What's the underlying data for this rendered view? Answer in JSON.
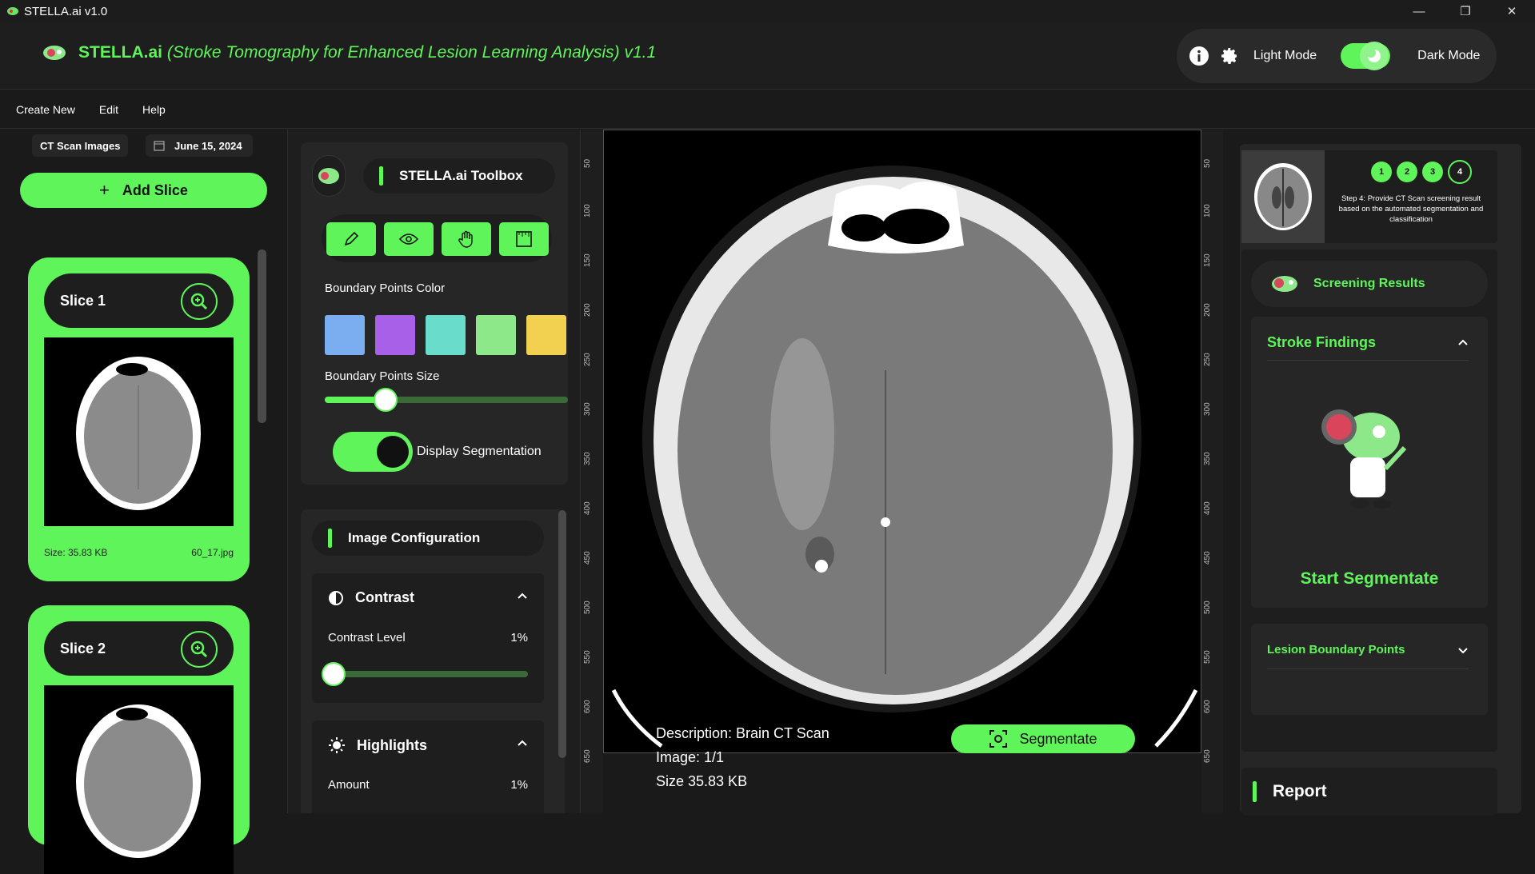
{
  "window": {
    "title": "STELLA.ai v1.0",
    "minimize": "—",
    "restore": "❐",
    "close": "✕"
  },
  "header": {
    "brand": "STELLA.ai",
    "subtitle": "(Stroke Tomography for Enhanced Lesion Learning Analysis) v1.1",
    "light_mode": "Light Mode",
    "dark_mode": "Dark Mode",
    "accent": "#5ff55a"
  },
  "menu": [
    "Create New",
    "Edit",
    "Help"
  ],
  "left": {
    "chip_label": "CT Scan Images",
    "date": "June 15, 2024",
    "add_slice": "Add Slice",
    "slices": [
      {
        "name": "Slice 1",
        "size": "Size: 35.83 KB",
        "file": "60_17.jpg"
      },
      {
        "name": "Slice 2"
      }
    ]
  },
  "toolbox": {
    "title": "STELLA.ai Toolbox",
    "tools": [
      "pencil-icon",
      "eye-icon",
      "hand-icon",
      "ruler-icon"
    ],
    "boundary_color_label": "Boundary Points Color",
    "colors": [
      "#7aaef0",
      "#a860e8",
      "#6adccc",
      "#8de88a",
      "#f2d050"
    ],
    "boundary_size_label": "Boundary Points Size",
    "boundary_size": 0.25,
    "display_segmentation": "Display Segmentation"
  },
  "config": {
    "title": "Image Configuration",
    "contrast": {
      "title": "Contrast",
      "label": "Contrast Level",
      "value": "1%",
      "level": 0.01
    },
    "highlights": {
      "title": "Highlights",
      "label": "Amount",
      "value": "1%"
    }
  },
  "viewer": {
    "ruler_ticks": [
      "50",
      "100",
      "150",
      "200",
      "250",
      "300",
      "350",
      "400",
      "450",
      "500",
      "550",
      "600",
      "650"
    ],
    "description": "Description: Brain CT Scan",
    "image": "Image: 1/1",
    "size": "Size 35.83 KB",
    "segmentate": "Segmentate"
  },
  "right": {
    "steps": [
      "1",
      "2",
      "3",
      "4"
    ],
    "step_desc": "Step 4: Provide CT Scan screening result based on the automated segmentation and classification",
    "screening": "Screening Results",
    "stroke_findings": "Stroke Findings",
    "start_segmentate": "Start Segmentate",
    "lesion_points": "Lesion Boundary Points",
    "report": "Report"
  }
}
